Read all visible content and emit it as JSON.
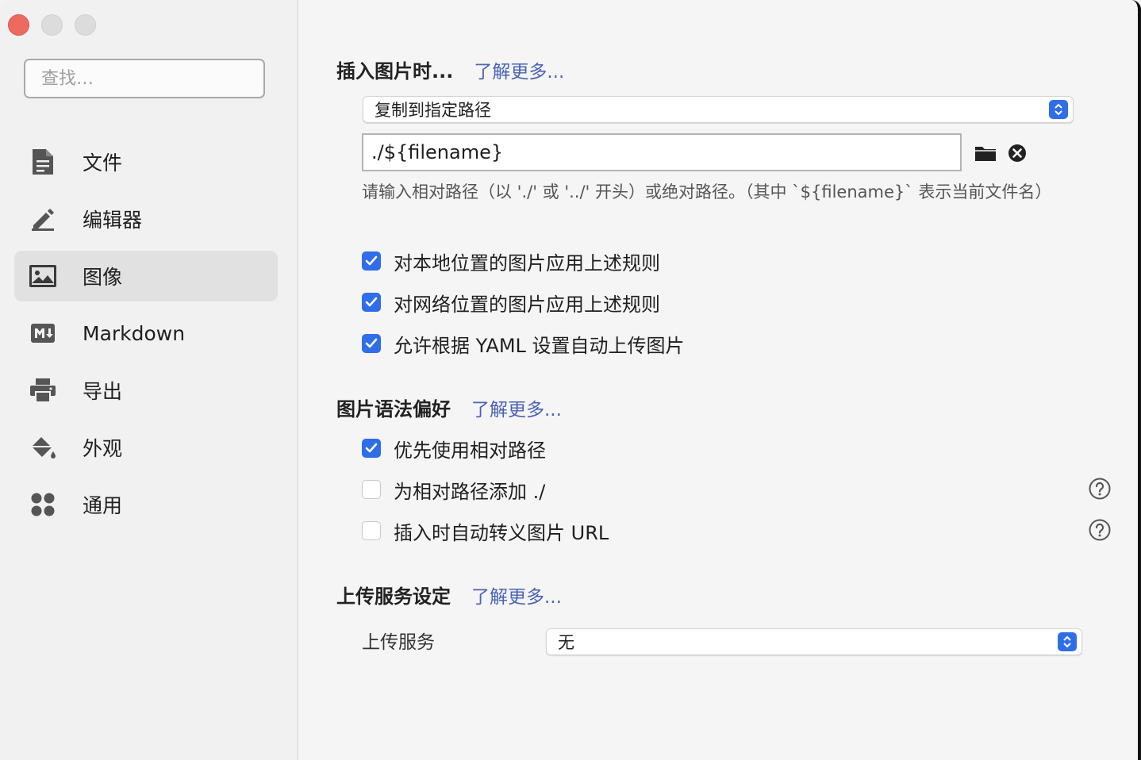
{
  "window": {
    "traffic_lights": [
      "close",
      "minimize",
      "zoom"
    ]
  },
  "sidebar": {
    "search_placeholder": "查找…",
    "items": [
      {
        "label": "文件",
        "icon": "file-icon",
        "active": false
      },
      {
        "label": "编辑器",
        "icon": "pencil-icon",
        "active": false
      },
      {
        "label": "图像",
        "icon": "image-icon",
        "active": true
      },
      {
        "label": "Markdown",
        "icon": "markdown-icon",
        "active": false
      },
      {
        "label": "导出",
        "icon": "printer-icon",
        "active": false
      },
      {
        "label": "外观",
        "icon": "paint-bucket-icon",
        "active": false
      },
      {
        "label": "通用",
        "icon": "grid-icon",
        "active": false
      }
    ]
  },
  "insert_image": {
    "title": "插入图片时...",
    "learn_more": "了解更多...",
    "action_select": "复制到指定路径",
    "path_value": "./${filename}",
    "hint": "请输入相对路径（以 './' 或 '../' 开头）或绝对路径。（其中 `${filename}` 表示当前文件名）",
    "options": [
      {
        "label": "对本地位置的图片应用上述规则",
        "checked": true
      },
      {
        "label": "对网络位置的图片应用上述规则",
        "checked": true
      },
      {
        "label": "允许根据 YAML 设置自动上传图片",
        "checked": true
      }
    ]
  },
  "syntax_pref": {
    "title": "图片语法偏好",
    "learn_more": "了解更多...",
    "options": [
      {
        "label": "优先使用相对路径",
        "checked": true,
        "help": false
      },
      {
        "label": "为相对路径添加 ./",
        "checked": false,
        "help": true
      },
      {
        "label": "插入时自动转义图片 URL",
        "checked": false,
        "help": true
      }
    ]
  },
  "upload": {
    "title": "上传服务设定",
    "learn_more": "了解更多...",
    "service_label": "上传服务",
    "service_value": "无"
  },
  "colors": {
    "accent": "#2f6ee8",
    "link": "#4a63b4",
    "close_light": "#ec6a5e"
  }
}
